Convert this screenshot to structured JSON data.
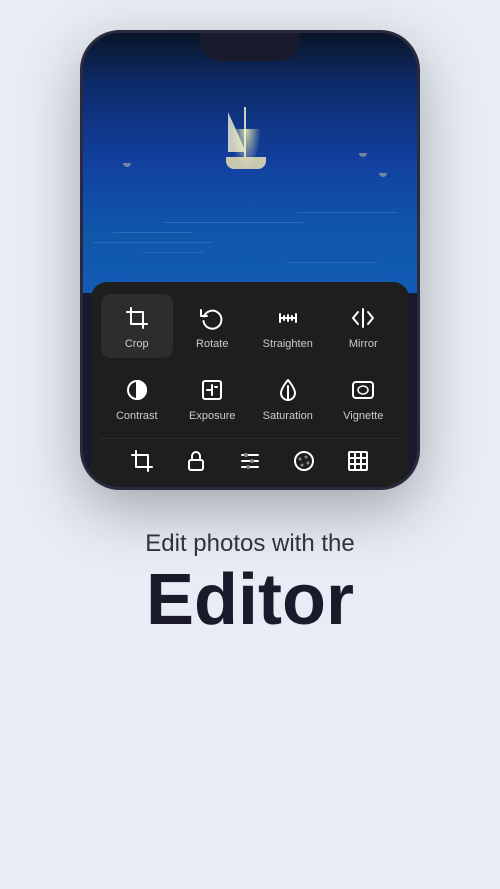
{
  "phone": {
    "tools_row1": [
      {
        "id": "crop",
        "label": "Crop",
        "icon": "crop",
        "active": true
      },
      {
        "id": "rotate",
        "label": "Rotate",
        "icon": "rotate",
        "active": false
      },
      {
        "id": "straighten",
        "label": "Straighten",
        "icon": "straighten",
        "active": false
      },
      {
        "id": "mirror",
        "label": "Mirror",
        "icon": "mirror",
        "active": false
      }
    ],
    "tools_row2": [
      {
        "id": "contrast",
        "label": "Contrast",
        "icon": "contrast",
        "active": false
      },
      {
        "id": "exposure",
        "label": "Exposure",
        "icon": "exposure",
        "active": false
      },
      {
        "id": "saturation",
        "label": "Saturation",
        "icon": "saturation",
        "active": false
      },
      {
        "id": "vignette",
        "label": "Vignette",
        "icon": "vignette",
        "active": false
      }
    ],
    "nav_icons": [
      "crop-nav",
      "lock-nav",
      "sliders-nav",
      "palette-nav",
      "grid-nav"
    ]
  },
  "page": {
    "subtitle": "Edit photos with the",
    "title": "Editor"
  }
}
